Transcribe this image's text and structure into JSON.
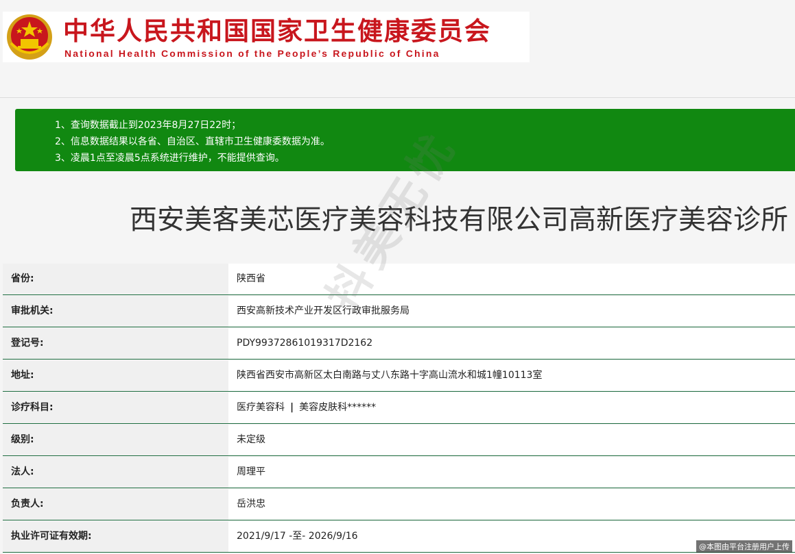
{
  "header": {
    "org_name_cn": "中华人民共和国国家卫生健康委员会",
    "org_name_en": "National Health Commission of the People’s Republic of China"
  },
  "notice": {
    "items": [
      "1、查询数据截止到2023年8月27日22时；",
      "2、信息数据结果以各省、自治区、直辖市卫生健康委数据为准。",
      "3、凌晨1点至凌晨5点系统进行维护，不能提供查询。"
    ]
  },
  "clinic": {
    "name": "西安美客美芯医疗美容科技有限公司高新医疗美容诊所"
  },
  "info": [
    {
      "label": "省份:",
      "value": "陕西省"
    },
    {
      "label": "审批机关:",
      "value": "西安高新技术产业开发区行政审批服务局"
    },
    {
      "label": "登记号:",
      "value": "PDY99372861019317D2162"
    },
    {
      "label": "地址:",
      "value": "陕西省西安市高新区太白南路与丈八东路十字高山流水和城1幢10113室"
    },
    {
      "label": "诊疗科目:",
      "value": "医疗美容科",
      "separator": "|",
      "value2": "美容皮肤科******"
    },
    {
      "label": "级别:",
      "value": "未定级"
    },
    {
      "label": "法人:",
      "value": "周理平"
    },
    {
      "label": "负责人:",
      "value": "岳洪忠"
    },
    {
      "label": "执业许可证有效期:",
      "value": "2021/9/17 -至- 2026/9/16"
    }
  ],
  "watermark": "抖美无忧",
  "corner_note": "@本图由平台注册用户上传",
  "colors": {
    "brand_red": "#c8161d",
    "notice_green": "#118811",
    "row_border": "#1c6b3e"
  }
}
